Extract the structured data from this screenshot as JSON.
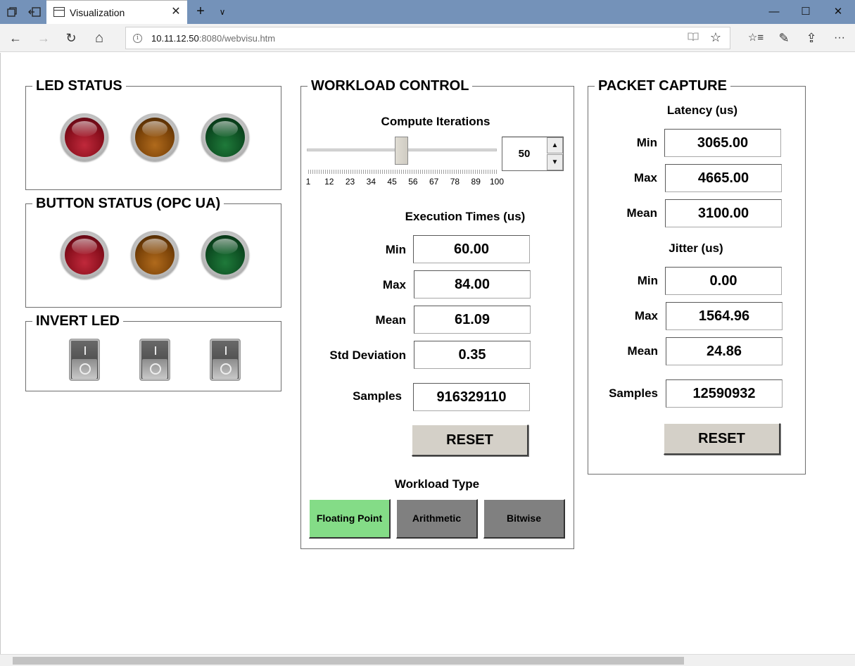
{
  "browser": {
    "tab_title": "Visualization",
    "tab_close": "✕",
    "new_tab": "+",
    "tab_list": "∨",
    "url_host": "10.11.12.50",
    "url_rest": ":8080/webvisu.htm",
    "win_minimize": "—",
    "win_maximize": "☐",
    "win_close": "✕",
    "nav_back": "←",
    "nav_forward": "→",
    "nav_refresh": "↻",
    "nav_home": "⌂",
    "read_icon": "📖",
    "fav_icon": "☆",
    "hub_icon": "☆≡",
    "notes_icon": "✎",
    "share_icon": "⇪",
    "more_icon": "···",
    "info_icon": "i"
  },
  "led_status": {
    "title": "LED STATUS",
    "leds": [
      {
        "color": "red"
      },
      {
        "color": "amber"
      },
      {
        "color": "green"
      }
    ]
  },
  "button_status": {
    "title": "BUTTON STATUS (OPC UA)",
    "leds": [
      {
        "color": "red"
      },
      {
        "color": "amber"
      },
      {
        "color": "green"
      }
    ]
  },
  "invert_led": {
    "title": "INVERT LED",
    "switches": 3
  },
  "workload": {
    "title": "WORKLOAD CONTROL",
    "compute_label": "Compute Iterations",
    "slider_value": 50,
    "slider_min": 1,
    "slider_max": 100,
    "tick_labels": [
      "1",
      "12",
      "23",
      "34",
      "45",
      "56",
      "67",
      "78",
      "89",
      "100"
    ],
    "spin_value": "50",
    "spin_up": "▲",
    "spin_down": "▼",
    "exec_title": "Execution Times (us)",
    "rows": [
      {
        "label": "Min",
        "value": "60.00"
      },
      {
        "label": "Max",
        "value": "84.00"
      },
      {
        "label": "Mean",
        "value": "61.09"
      },
      {
        "label": "Std Deviation",
        "value": "0.35"
      }
    ],
    "samples_label": "Samples",
    "samples_value": "916329110",
    "reset_label": "RESET",
    "type_title": "Workload Type",
    "types": [
      {
        "label": "Floating Point",
        "color": "#84dc87",
        "selected": true
      },
      {
        "label": "Arithmetic",
        "color": "#808080",
        "selected": false
      },
      {
        "label": "Bitwise",
        "color": "#808080",
        "selected": false
      }
    ]
  },
  "packet": {
    "title": "PACKET CAPTURE",
    "latency_title": "Latency (us)",
    "latency": [
      {
        "label": "Min",
        "value": "3065.00"
      },
      {
        "label": "Max",
        "value": "4665.00"
      },
      {
        "label": "Mean",
        "value": "3100.00"
      }
    ],
    "jitter_title": "Jitter (us)",
    "jitter": [
      {
        "label": "Min",
        "value": "0.00"
      },
      {
        "label": "Max",
        "value": "1564.96"
      },
      {
        "label": "Mean",
        "value": "24.86"
      }
    ],
    "samples_label": "Samples",
    "samples_value": "12590932",
    "reset_label": "RESET"
  }
}
